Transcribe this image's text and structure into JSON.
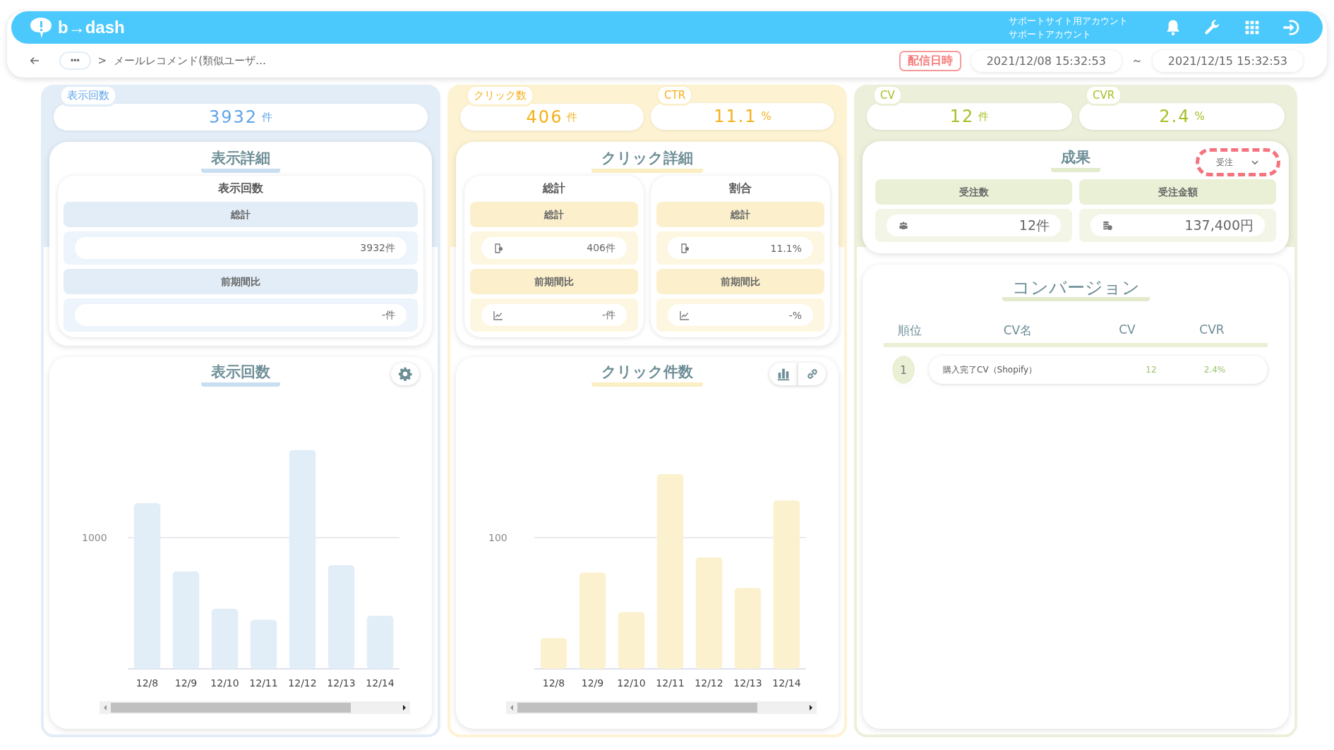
{
  "header": {
    "logo": "b→dash",
    "account_lines": [
      "サポートサイト用アカウント",
      "サポートアカウント"
    ],
    "icons": [
      {
        "kind": "bell"
      },
      {
        "kind": "wrench"
      },
      {
        "kind": "grid"
      },
      {
        "kind": "logout"
      }
    ]
  },
  "breadcrumb": {
    "more": "•••",
    "separator": ">",
    "current": "メールレコメンド(類似ユーザ…"
  },
  "period": {
    "label": "配信日時",
    "start": "2021/12/08 15:32:53",
    "separator": "～",
    "end": "2021/12/15 15:32:53"
  },
  "columns": [
    {
      "metrics": [
        {
          "label": "表示回数",
          "value": "3932",
          "unit": "件"
        }
      ],
      "detail": {
        "title": "表示詳細",
        "groups": [
          {
            "title": "表示回数",
            "rows": [
              {
                "kind": "header",
                "label": "総計"
              },
              {
                "kind": "value",
                "value": "3932件"
              },
              {
                "kind": "header",
                "label": "前期間比"
              },
              {
                "kind": "value",
                "value": "-件"
              }
            ]
          }
        ]
      },
      "chart": {
        "title": "表示回数",
        "tools": [
          {
            "kind": "gear"
          }
        ],
        "y_label": "1000",
        "x_labels": [
          "12/8",
          "12/9",
          "12/10",
          "12/11",
          "12/12",
          "12/13",
          "12/14"
        ]
      }
    },
    {
      "metrics": [
        {
          "label": "クリック数",
          "value": "406",
          "unit": "件"
        },
        {
          "label": "CTR",
          "value": "11.1",
          "unit": "%"
        }
      ],
      "detail": {
        "title": "クリック詳細",
        "groups": [
          {
            "title": "総計",
            "rows": [
              {
                "kind": "header",
                "label": "総計"
              },
              {
                "kind": "value",
                "value": "406件"
              },
              {
                "kind": "header",
                "label": "前期間比"
              },
              {
                "kind": "value",
                "value": "-件"
              }
            ]
          },
          {
            "title": "割合",
            "rows": [
              {
                "kind": "header",
                "label": "総計"
              },
              {
                "kind": "value",
                "value": "11.1%"
              },
              {
                "kind": "header",
                "label": "前期間比"
              },
              {
                "kind": "value",
                "value": "-%"
              }
            ]
          }
        ]
      },
      "chart": {
        "title": "クリック件数",
        "tools": [
          {
            "kind": "bar-chart"
          },
          {
            "kind": "link"
          }
        ],
        "y_label": "100",
        "x_labels": [
          "12/8",
          "12/9",
          "12/10",
          "12/11",
          "12/12",
          "12/13",
          "12/14"
        ]
      }
    }
  ],
  "outcome": {
    "metrics": [
      {
        "label": "CV",
        "value": "12",
        "unit": "件"
      },
      {
        "label": "CVR",
        "value": "2.4",
        "unit": "%"
      }
    ],
    "results": {
      "title": "成果",
      "dropdown": {
        "value": "受注"
      },
      "items": [
        {
          "label": "受注数",
          "kind": "people",
          "value": "12件"
        },
        {
          "label": "受注金額",
          "kind": "coins",
          "value": "137,400円"
        }
      ]
    },
    "conversion": {
      "title": "コンバージョン",
      "columns": [
        "順位",
        "CV名",
        "CV",
        "CVR"
      ],
      "rows": [
        {
          "rank": "1",
          "name": "購入完了CV（Shopify）",
          "cv": "12",
          "cvr": "2.4%"
        }
      ]
    }
  }
}
